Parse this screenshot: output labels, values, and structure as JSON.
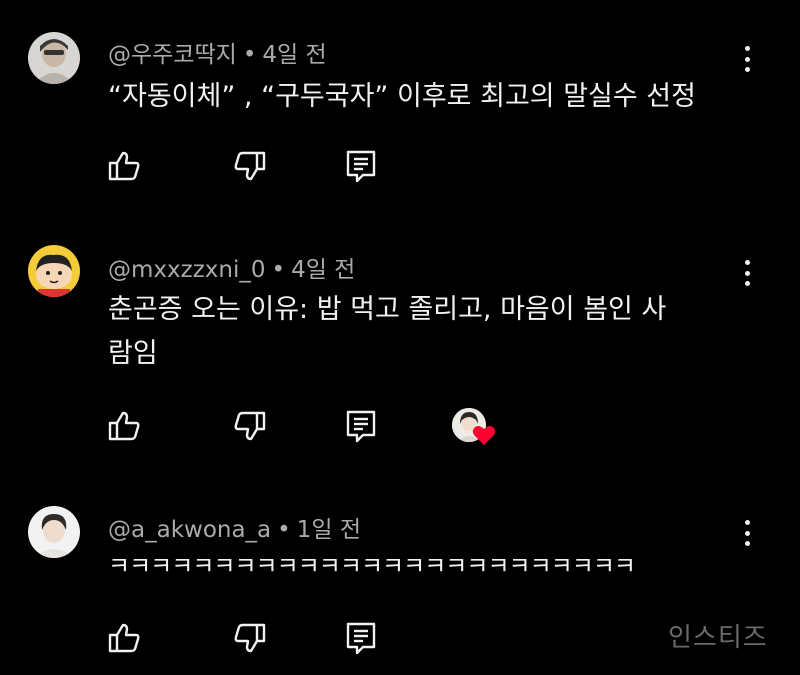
{
  "comments": [
    {
      "username": "@우주코딱지",
      "separator": "•",
      "time": "4일 전",
      "text": "“자동이체” , “구두국자” 이후로 최고의 말실수 선정"
    },
    {
      "username": "@mxxzzxni_0",
      "separator": "•",
      "time": "4일 전",
      "text": "춘곤증 오는 이유: 밥 먹고 졸리고, 마음이 봄인 사람임"
    },
    {
      "username": "@a_akwona_a",
      "separator": "•",
      "time": "1일 전",
      "text": "ㅋㅋㅋㅋㅋㅋㅋㅋㅋㅋㅋㅋㅋㅋㅋㅋㅋㅋㅋㅋㅋㅋㅋㅋㅋ"
    }
  ],
  "watermark": "인스티즈",
  "icons": {
    "like": "thumbs-up-icon",
    "dislike": "thumbs-down-icon",
    "reply": "reply-icon",
    "more": "more-vert-icon",
    "creator_heart": "heart-icon"
  },
  "colors": {
    "background": "#000000",
    "text": "#f1f1f1",
    "meta": "#aaaaaa",
    "heart": "#ff0033"
  }
}
